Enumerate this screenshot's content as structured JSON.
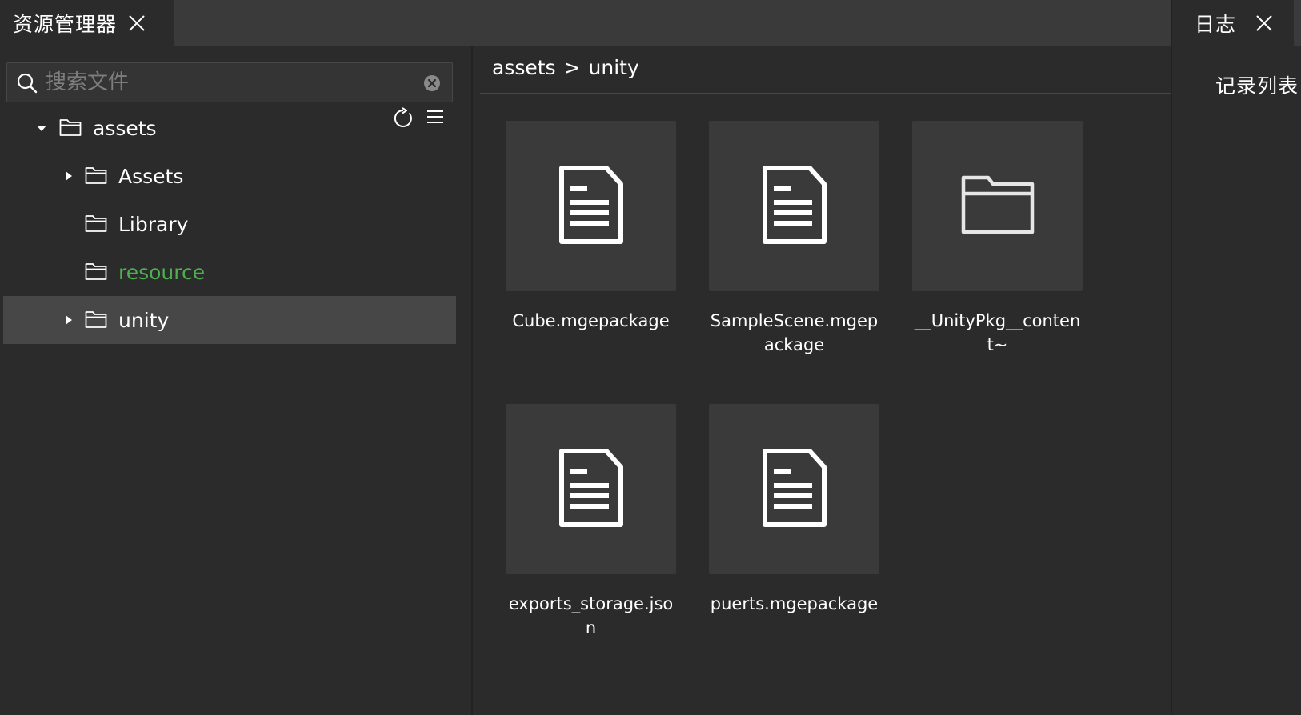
{
  "explorer": {
    "tab_title": "资源管理器",
    "search": {
      "placeholder": "搜索文件",
      "value": ""
    },
    "tree": [
      {
        "label": "assets",
        "level": 0,
        "expanded": true,
        "has_children": true,
        "selected": false,
        "color": "#ffffff"
      },
      {
        "label": "Assets",
        "level": 1,
        "expanded": false,
        "has_children": true,
        "selected": false,
        "color": "#ffffff"
      },
      {
        "label": "Library",
        "level": 1,
        "expanded": false,
        "has_children": false,
        "selected": false,
        "color": "#ffffff"
      },
      {
        "label": "resource",
        "level": 1,
        "expanded": false,
        "has_children": false,
        "selected": false,
        "color": "#4caf50"
      },
      {
        "label": "unity",
        "level": 1,
        "expanded": false,
        "has_children": true,
        "selected": true,
        "color": "#ffffff"
      }
    ]
  },
  "main": {
    "breadcrumb": [
      "assets",
      ">",
      "unity"
    ],
    "files": [
      {
        "name": "Cube.mgepackage",
        "icon": "file-icon"
      },
      {
        "name": "SampleScene.mgepackage",
        "icon": "file-icon"
      },
      {
        "name": "__UnityPkg__content~",
        "icon": "folder-icon"
      },
      {
        "name": "exports_storage.json",
        "icon": "file-icon"
      },
      {
        "name": "puerts.mgepackage",
        "icon": "file-icon"
      }
    ]
  },
  "log": {
    "tab_title": "日志",
    "list_title": "记录列表"
  },
  "colors": {
    "background": "#2b2b2b",
    "tabbar": "#3a3a3a",
    "selected_row": "#474747",
    "accent_green": "#4caf50"
  }
}
